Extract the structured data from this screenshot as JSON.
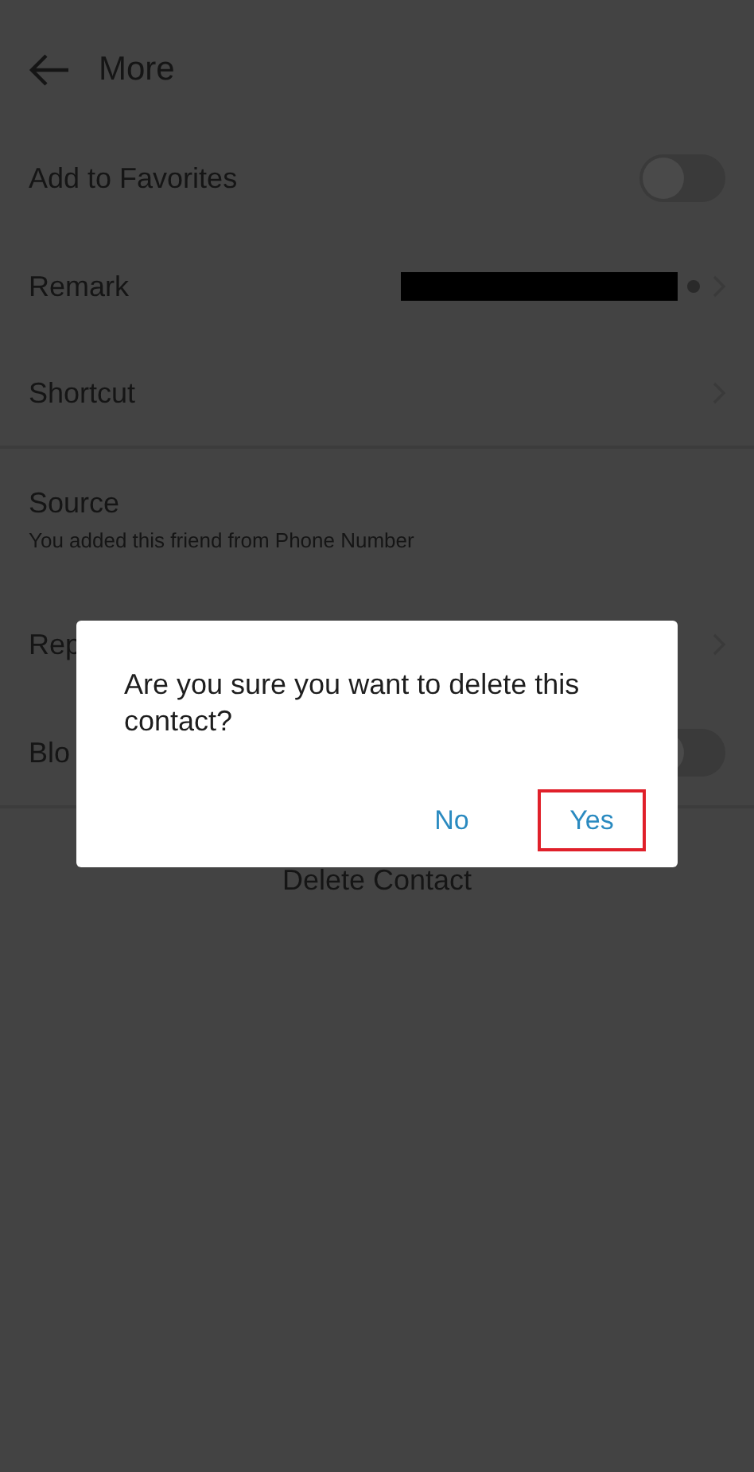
{
  "header": {
    "title": "More"
  },
  "rows": [
    {
      "kind": "toggle",
      "label": "Add to Favorites",
      "on": false
    },
    {
      "kind": "redacted",
      "label": "Remark"
    },
    {
      "kind": "link",
      "label": "Shortcut"
    },
    {
      "kind": "info",
      "label": "Source",
      "subtitle": "You added this friend from Phone Number"
    },
    {
      "kind": "link",
      "label": "Rep"
    },
    {
      "kind": "toggle",
      "label": "Blo",
      "on": false
    }
  ],
  "action": {
    "label": "Delete Contact"
  },
  "dialog": {
    "message": "Are you sure you want to delete this contact?",
    "buttons": [
      {
        "label": "No",
        "highlighted": false
      },
      {
        "label": "Yes",
        "highlighted": true
      }
    ]
  }
}
